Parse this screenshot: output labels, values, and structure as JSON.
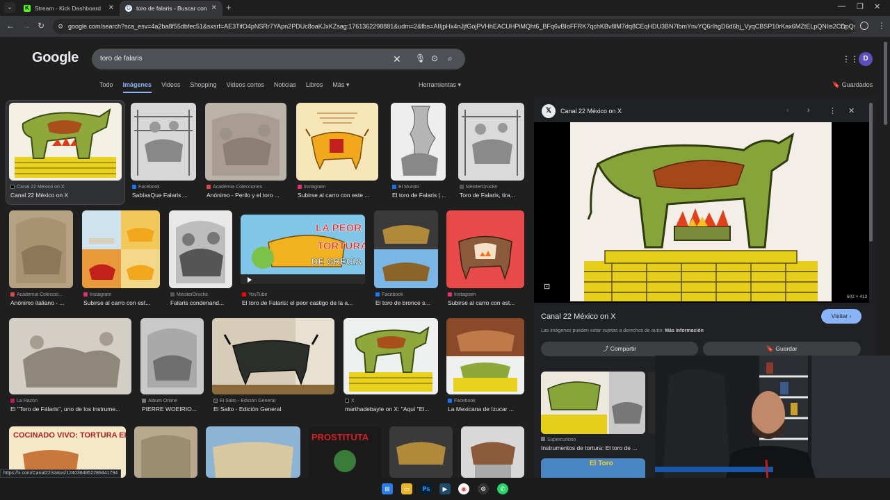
{
  "browser": {
    "tabs": [
      {
        "title": "Stream - Kick Dashboard",
        "favicon": "K",
        "color": "#53fc18"
      },
      {
        "title": "toro de falaris - Buscar con Goo",
        "favicon": "G",
        "color": "#4285f4"
      }
    ],
    "new_tab": "+",
    "url": "google.com/search?sca_esv=4a2ba8f55dbfec51&sxsrf=AE3TifO4pNSRr7YApn2PDUc8oaKJxKZsag:1761362298881&udm=2&fbs=AIIjpHx4nJjfGojPVHhEACUHPiMQht6_BFq6vBIoFFRK7qchKBv8lM7dq8CEqHDU3BN7lbmYnvYQ6rIhgD6d6bj_VyqCBSP10rKax6MZtELpQNIis2CDpQsf1INL42..."
  },
  "google": {
    "logo": "Google",
    "query": "toro de falaris",
    "tabs": [
      "Todo",
      "Imágenes",
      "Videos",
      "Shopping",
      "Videos cortos",
      "Noticias",
      "Libros",
      "Más ▾"
    ],
    "active_tab": "Imágenes",
    "tools": "Herramientas ▾",
    "saved": "Guardados",
    "avatar_letter": "D"
  },
  "results": {
    "row1": [
      {
        "source": "Canal 22 México on X",
        "caption": "Canal 22 México on X",
        "dot": "#000000"
      },
      {
        "source": "Facebook",
        "caption": "SabíasQue Falaris ...",
        "dot": "#1877f2"
      },
      {
        "source": "Academia Colecciones",
        "caption": "Anónimo - Perilo y el toro ...",
        "dot": "#e04848"
      },
      {
        "source": "Instagram",
        "caption": "Subirse al carro con este ...",
        "dot": "#e1306c"
      },
      {
        "source": "El Mundo",
        "caption": "El toro de Falaris | ...",
        "dot": "#1a73e8"
      },
      {
        "source": "MeisterDrucke",
        "caption": "Toro de Falaris, tira...",
        "dot": "#555555"
      }
    ],
    "row2": [
      {
        "source": "Academia Coleccio...",
        "caption": "Anónimo italiano - ...",
        "dot": "#e04848"
      },
      {
        "source": "Instagram",
        "caption": "Subirse al carro con est...",
        "dot": "#e1306c"
      },
      {
        "source": "MeisterDrucke",
        "caption": "Falaris condenand...",
        "dot": "#555555"
      },
      {
        "source": "YouTube",
        "caption": "El toro de Falaris: el peor castigo de la a...",
        "dot": "#ff0000"
      },
      {
        "source": "Facebook",
        "caption": "El toro de bronce s...",
        "dot": "#1877f2"
      },
      {
        "source": "Instagram",
        "caption": "Subirse al carro con est...",
        "dot": "#e1306c"
      }
    ],
    "row3": [
      {
        "source": "La Razón",
        "caption": "El \"Toro de Fálaris\", uno de los instrume...",
        "dot": "#c2185b"
      },
      {
        "source": "Album Online",
        "caption": "PIERRE WOEIRIO...",
        "dot": "#777777"
      },
      {
        "source": "El Salto - Edición General",
        "caption": "El Salto - Edición General",
        "dot": "#333333"
      },
      {
        "source": "X",
        "caption": "marthadebayle on X: \"Aquí \"El...",
        "dot": "#000000"
      },
      {
        "source": "Facebook",
        "caption": "La Mexicana de Izucar ...",
        "dot": "#1877f2"
      }
    ],
    "row4_text": {
      "title": "COCINADO VIVO: TORTURA EL TORO DE FALARIS",
      "prostitu": "PROSTITUTA"
    },
    "youtube_banner": {
      "line1": "LA PEOR",
      "line2": "TORTURA",
      "line3": "DE GRECIA"
    }
  },
  "panel": {
    "source": "Canal 22 México on X",
    "dimensions": "602 × 413",
    "title": "Canal 22 México on X",
    "visit": "Visitar ›",
    "copyright": "Las imágenes pueden estar sujetas a derechos de autor.",
    "more_info": "Más información",
    "share": "Compartir",
    "save": "Guardar",
    "related_source": "Supercurioso",
    "related_caption": "Instrumentos de tortura: El toro de ...",
    "related_peek": "El Toro"
  },
  "status_url": "https://x.com/Canal22/status/1240364852289441794",
  "colors": {
    "accent": "#8ab4f8",
    "bg": "#1f1f1f"
  }
}
